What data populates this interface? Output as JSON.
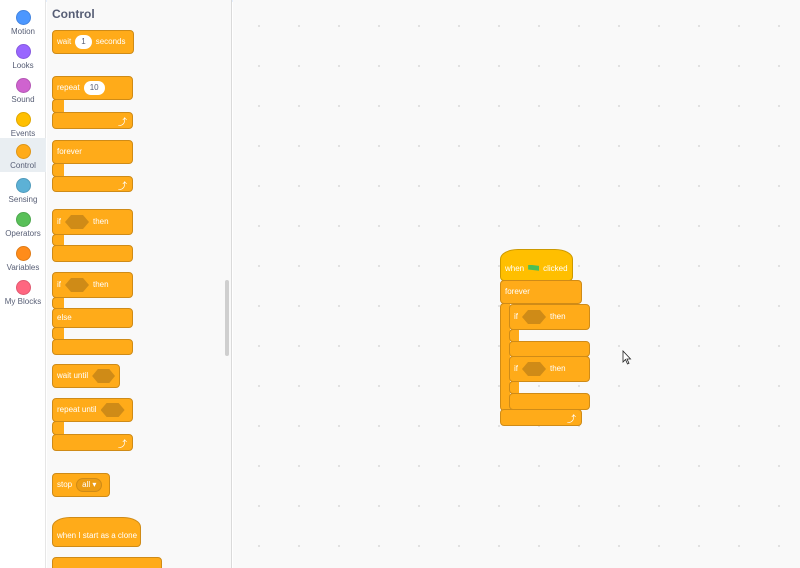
{
  "categories": [
    {
      "label": "Motion",
      "color": "#4c97ff"
    },
    {
      "label": "Looks",
      "color": "#9966ff"
    },
    {
      "label": "Sound",
      "color": "#cf63cf"
    },
    {
      "label": "Events",
      "color": "#ffbf00"
    },
    {
      "label": "Control",
      "color": "#ffab19"
    },
    {
      "label": "Sensing",
      "color": "#5cb1d6"
    },
    {
      "label": "Operators",
      "color": "#59c059"
    },
    {
      "label": "Variables",
      "color": "#ff8c1a"
    },
    {
      "label": "My Blocks",
      "color": "#ff6680"
    }
  ],
  "palette": {
    "title": "Control",
    "wait": {
      "label": "wait",
      "value": "1",
      "suffix": "seconds"
    },
    "repeat": {
      "label": "repeat",
      "value": "10"
    },
    "forever": {
      "label": "forever"
    },
    "if_then": {
      "if": "if",
      "then": "then"
    },
    "if_else": {
      "if": "if",
      "then": "then",
      "else": "else"
    },
    "wait_until": {
      "label": "wait until"
    },
    "repeat_until": {
      "label": "repeat until"
    },
    "stop": {
      "label": "stop",
      "option": "all ▾"
    },
    "clone_start": {
      "label": "when I start as a clone"
    }
  },
  "script": {
    "hat": {
      "when": "when",
      "clicked": "clicked"
    },
    "forever": "forever",
    "if1": {
      "if": "if",
      "then": "then"
    },
    "if2": {
      "if": "if",
      "then": "then"
    }
  },
  "colors": {
    "control": "#ffab19",
    "control_border": "#cf8b17",
    "green_flag": "#4cbf56"
  }
}
